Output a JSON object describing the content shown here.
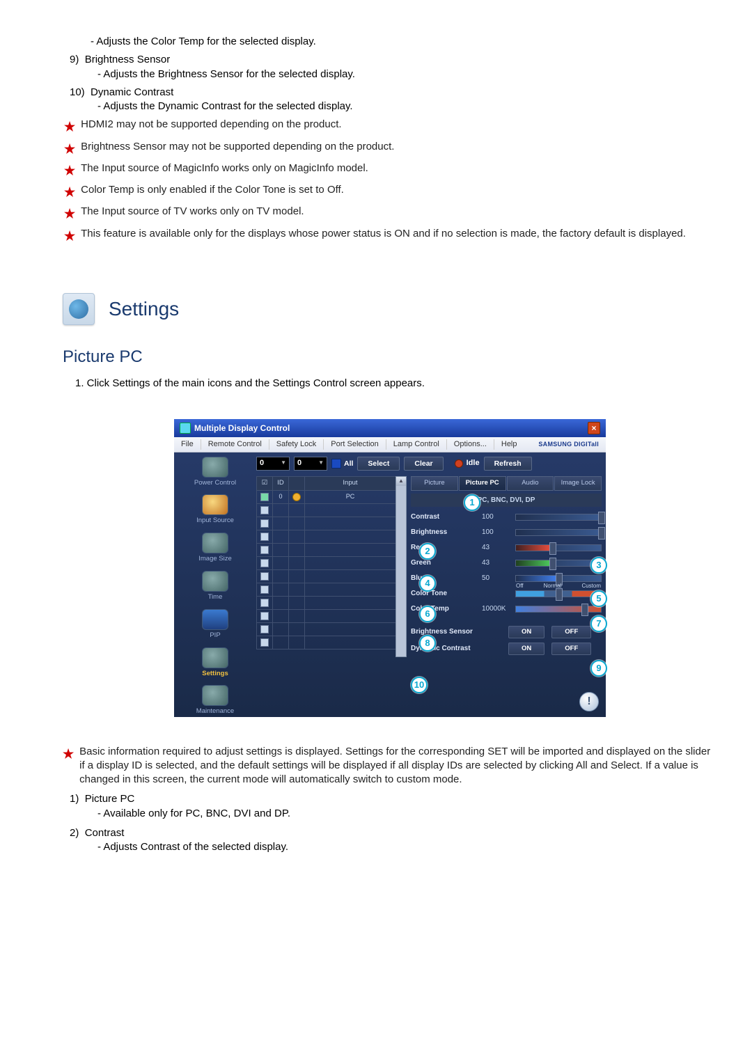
{
  "top": {
    "colortemp_sub": "- Adjusts the Color Temp for the selected display.",
    "item9_num": "9)",
    "item9_title": "Brightness Sensor",
    "item9_sub": "- Adjusts the Brightness Sensor for the selected display.",
    "item10_num": "10)",
    "item10_title": "Dynamic Contrast",
    "item10_sub": "- Adjusts the Dynamic Contrast for the selected display."
  },
  "notes": {
    "n1": "HDMI2 may not be supported depending on the product.",
    "n2": "Brightness Sensor may not be supported depending on the product.",
    "n3": "The Input source of MagicInfo works only on MagicInfo model.",
    "n4": "Color Temp is only enabled if the Color Tone is set to Off.",
    "n5": "The Input source of TV works only on TV model.",
    "n6": "This feature is available only for the displays whose power status is ON and if no selection is made, the factory default is displayed."
  },
  "settings_title": "Settings",
  "picture_pc_title": "Picture PC",
  "instr1": "1.  Click Settings of the main icons and the Settings Control screen appears.",
  "mdc": {
    "window_title": "Multiple Display Control",
    "close": "×",
    "menu": {
      "file": "File",
      "remote": "Remote Control",
      "safety": "Safety Lock",
      "port": "Port Selection",
      "lamp": "Lamp Control",
      "options": "Options...",
      "help": "Help"
    },
    "brand": "SAMSUNG DIGITall",
    "spinner1": "0",
    "spinner2": "0",
    "all_label": "All",
    "select_btn": "Select",
    "clear_btn": "Clear",
    "idle_label": "Idle",
    "refresh_btn": "Refresh",
    "sidebar": {
      "power": "Power Control",
      "input": "Input Source",
      "image": "Image Size",
      "time": "Time",
      "pip": "PIP",
      "settings": "Settings",
      "maint": "Maintenance"
    },
    "grid": {
      "h_chk": "☑",
      "h_id": "ID",
      "h_ico": "",
      "h_input": "Input",
      "row_id": "0",
      "row_input": "PC"
    },
    "tabs": {
      "picture": "Picture",
      "picture_pc": "Picture PC",
      "audio": "Audio",
      "image_lock": "Image Lock"
    },
    "panel_sub": "PC, BNC, DVI, DP",
    "rows": {
      "contrast_l": "Contrast",
      "contrast_v": "100",
      "brightness_l": "Brightness",
      "brightness_v": "100",
      "red_l": "Red",
      "red_v": "43",
      "green_l": "Green",
      "green_v": "43",
      "blue_l": "Blue",
      "blue_v": "50",
      "tone_l": "Color Tone",
      "tone_off": "Off",
      "tone_normal": "Normal",
      "tone_custom": "Custom",
      "temp_l": "Color Temp",
      "temp_v": "10000K",
      "bsensor_l": "Brightness Sensor",
      "dcontrast_l": "Dynamic Contrast",
      "on": "ON",
      "off": "OFF"
    },
    "slider_percent": {
      "contrast": 100,
      "brightness": 100,
      "red": 43,
      "green": 43,
      "blue": 50,
      "temp": 80
    },
    "footer_info": "!"
  },
  "post_note": "Basic information required to adjust settings is displayed. Settings for the corresponding SET will be imported and displayed on the slider if a display ID is selected, and the default settings will be displayed if all display IDs are selected by clicking All and Select. If a value is changed in this screen, the current mode will automatically switch to custom mode.",
  "post_items": {
    "i1_num": "1)",
    "i1_title": "Picture PC",
    "i1_sub": "- Available only for PC, BNC, DVI and DP.",
    "i2_num": "2)",
    "i2_title": "Contrast",
    "i2_sub": "- Adjusts Contrast of the selected display."
  }
}
